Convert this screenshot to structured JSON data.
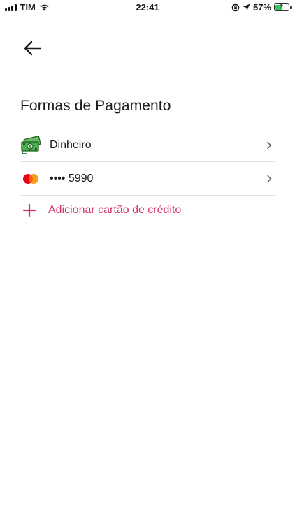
{
  "status_bar": {
    "carrier": "TIM",
    "time": "22:41",
    "battery_percent": "57%",
    "battery_level": 0.57,
    "icons": [
      "signal-icon",
      "wifi-icon",
      "rotation-lock-icon",
      "location-arrow-icon",
      "battery-icon"
    ]
  },
  "header": {
    "back_icon": "arrow-left-icon"
  },
  "page": {
    "title": "Formas de Pagamento"
  },
  "payment_methods": [
    {
      "icon": "cash-money-icon",
      "label": "Dinheiro"
    },
    {
      "icon": "mastercard-icon",
      "label": "•••• 5990"
    }
  ],
  "add_card": {
    "icon": "plus-icon",
    "label": "Adicionar cartão de crédito"
  },
  "colors": {
    "accent": "#d6336c",
    "divider": "#e2e2e2",
    "text": "#1a1a1a",
    "mastercard_red": "#eb001b",
    "mastercard_orange": "#f79e1b",
    "cash_green": "#4caf50",
    "battery_green": "#34c759"
  }
}
